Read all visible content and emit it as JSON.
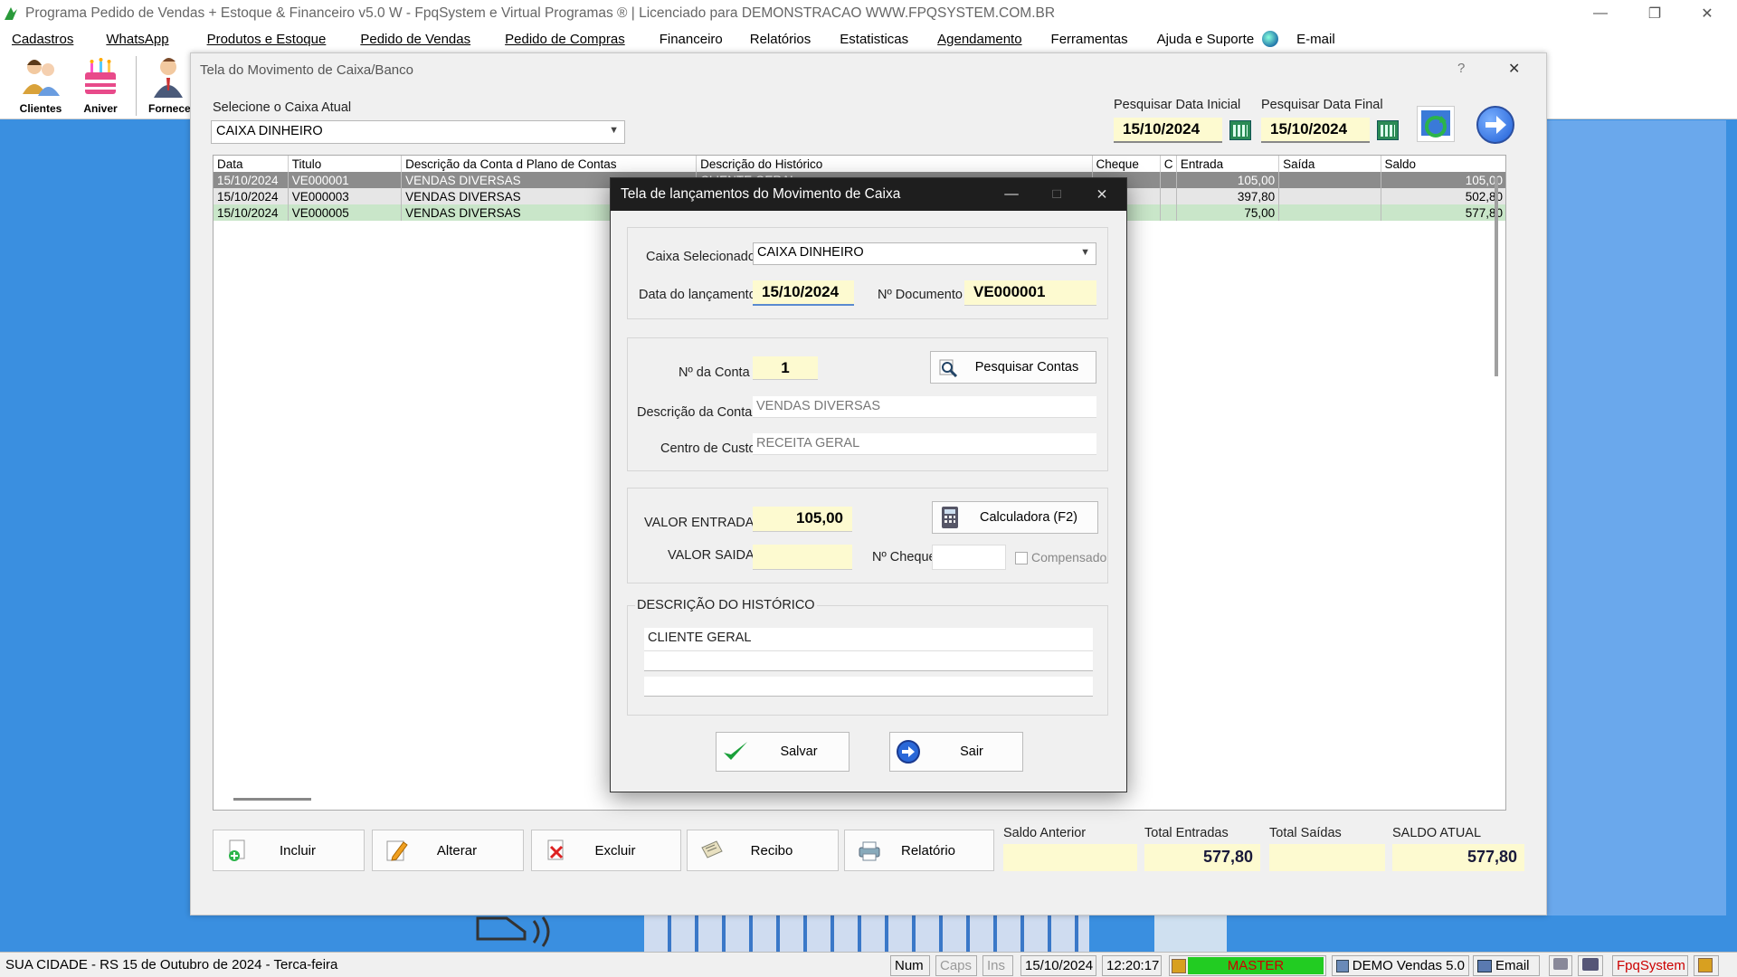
{
  "app": {
    "title": "Programa Pedido de Vendas + Estoque & Financeiro v5.0 W - FpqSystem e Virtual Programas ® | Licenciado para  DEMONSTRACAO WWW.FPQSYSTEM.COM.BR",
    "menu": [
      "Cadastros",
      "WhatsApp",
      "Produtos e Estoque",
      "Pedido de Vendas",
      "Pedido de Compras",
      "Financeiro",
      "Relatórios",
      "Estatisticas",
      "Agendamento",
      "Ferramentas",
      "Ajuda e Suporte",
      "E-mail"
    ],
    "toolbar": [
      "Clientes",
      "Aniver",
      "Fornece"
    ]
  },
  "form": {
    "title": "Tela do Movimento de Caixa/Banco",
    "help": "?",
    "close": "✕",
    "caixa_label": "Selecione o Caixa Atual",
    "caixa_value": "CAIXA DINHEIRO",
    "data_inicial_label": "Pesquisar Data Inicial",
    "data_inicial": "15/10/2024",
    "data_final_label": "Pesquisar Data Final",
    "data_final": "15/10/2024"
  },
  "grid": {
    "headers": [
      "Data",
      "Titulo",
      "Descrição da Conta d Plano de Contas",
      "Descrição do Histórico",
      "Cheque",
      "C",
      "Entrada",
      "Saída",
      "Saldo"
    ],
    "rows": [
      [
        "15/10/2024",
        "VE000001",
        "VENDAS DIVERSAS",
        "CLIENTE GERAL",
        "",
        "",
        "105,00",
        "",
        "105,00"
      ],
      [
        "15/10/2024",
        "VE000003",
        "VENDAS DIVERSAS",
        "",
        "",
        "",
        "397,80",
        "",
        "502,80"
      ],
      [
        "15/10/2024",
        "VE000005",
        "VENDAS DIVERSAS",
        "",
        "",
        "",
        "75,00",
        "",
        "577,80"
      ]
    ]
  },
  "buttons": {
    "incluir": "Incluir",
    "alterar": "Alterar",
    "excluir": "Excluir",
    "recibo": "Recibo",
    "relatorio": "Relatório"
  },
  "totals": {
    "saldo_anterior_label": "Saldo Anterior",
    "saldo_anterior": "",
    "total_entradas_label": "Total Entradas",
    "total_entradas": "577,80",
    "total_saidas_label": "Total Saídas",
    "total_saidas": "",
    "saldo_atual_label": "SALDO ATUAL",
    "saldo_atual": "577,80"
  },
  "dialog": {
    "title": "Tela de lançamentos do Movimento de Caixa",
    "caixa_label": "Caixa Selecionado",
    "caixa_value": "CAIXA DINHEIRO",
    "data_label": "Data do lançamento",
    "data_value": "15/10/2024",
    "doc_label": "Nº Documento",
    "doc_value": "VE000001",
    "conta_label": "Nº da Conta",
    "conta_value": "1",
    "pesquisar_contas": "Pesquisar Contas",
    "desc_conta_label": "Descrição da Conta",
    "desc_conta_value": "VENDAS DIVERSAS",
    "centro_label": "Centro de Custo",
    "centro_value": "RECEITA GERAL",
    "valor_entrada_label": "VALOR ENTRADA",
    "valor_entrada": "105,00",
    "calculadora": "Calculadora  (F2)",
    "valor_saida_label": "VALOR SAIDA",
    "valor_saida": "",
    "cheque_label": "Nº Cheque",
    "cheque_value": "",
    "compensado_label": "Compensado",
    "historico_label": "DESCRIÇÃO DO HISTÓRICO",
    "historico_line1": "CLIENTE GERAL",
    "historico_line2": "",
    "salvar": "Salvar",
    "sair": "Sair"
  },
  "status": {
    "location": "SUA CIDADE - RS 15 de Outubro de 2024 - Terca-feira",
    "num": "Num",
    "caps": "Caps",
    "ins": "Ins",
    "date": "15/10/2024",
    "time": "12:20:17",
    "user": "MASTER",
    "version": "DEMO Vendas 5.0",
    "email": "Email",
    "brand": "FpqSystem"
  },
  "colors": {
    "desktop": "#3a8fe0",
    "highlight_field": "#fdfad0",
    "master_bar": "#22cc22",
    "brand_red": "#cc0000"
  }
}
